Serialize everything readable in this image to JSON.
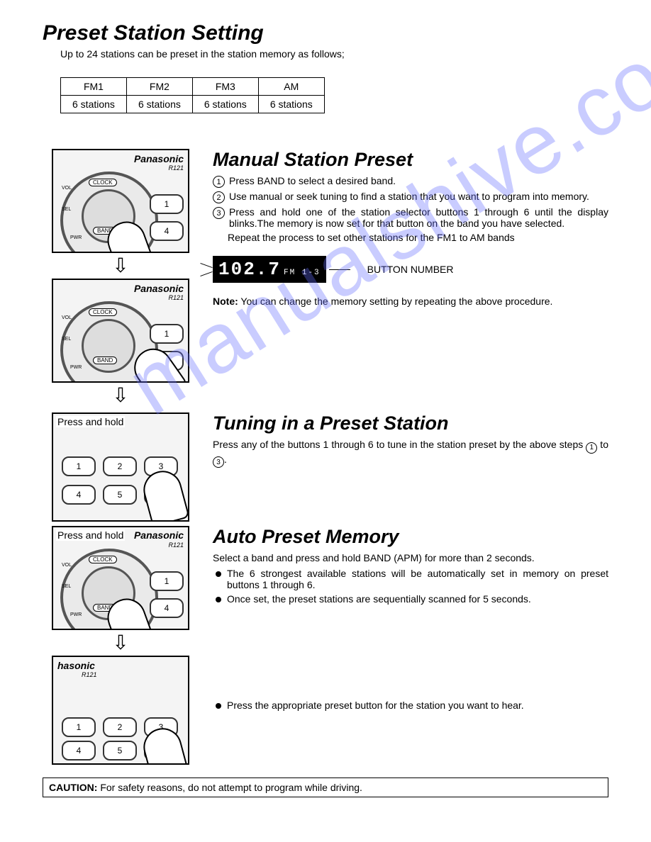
{
  "title": "Preset Station Setting",
  "subtitle": "Up to 24 stations can be preset in the station memory as follows;",
  "bands_table": {
    "headers": [
      "FM1",
      "FM2",
      "FM3",
      "AM"
    ],
    "row": [
      "6 stations",
      "6 stations",
      "6 stations",
      "6 stations"
    ]
  },
  "brand": "Panasonic",
  "model": "R121",
  "dial_labels": {
    "clock": "CLOCK",
    "band": "BAND",
    "vol": "VOL",
    "sel": "SEL",
    "pwr": "PWR"
  },
  "manual": {
    "heading": "Manual Station Preset",
    "steps": [
      "Press BAND to select a desired band.",
      "Use manual or seek tuning to find a station that you want to program into memory.",
      "Press and hold one of the station selector buttons 1 through 6 until the display blinks.The memory is now set for that button on the band you have selected."
    ],
    "repeat": "Repeat the process to set other stations for the FM1 to AM bands",
    "display_freq": "102.7",
    "display_band": "FM 1-3",
    "display_label": "BUTTON NUMBER",
    "note_label": "Note:",
    "note_text": "You can change the memory setting by repeating the above procedure."
  },
  "press_hold_label": "Press and hold",
  "tuning": {
    "heading": "Tuning in a Preset Station",
    "text_a": "Press any of  the buttons 1 through 6 to tune in the station preset by the above steps ",
    "text_b": " to ",
    "text_c": "."
  },
  "auto": {
    "heading": "Auto Preset Memory",
    "intro": "Select a band and press and hold BAND (APM) for more than 2 seconds.",
    "bullets": [
      "The 6 strongest available stations will be automatically set in memory on preset buttons 1 through 6.",
      "Once set, the  preset stations are sequentially scanned for 5 seconds."
    ],
    "final_bullet": "Press the appropriate preset button for the station you want to hear."
  },
  "caution_label": "CAUTION:",
  "caution_text": " For safety reasons, do not attempt to program while driving.",
  "watermark": "manualshive.com"
}
